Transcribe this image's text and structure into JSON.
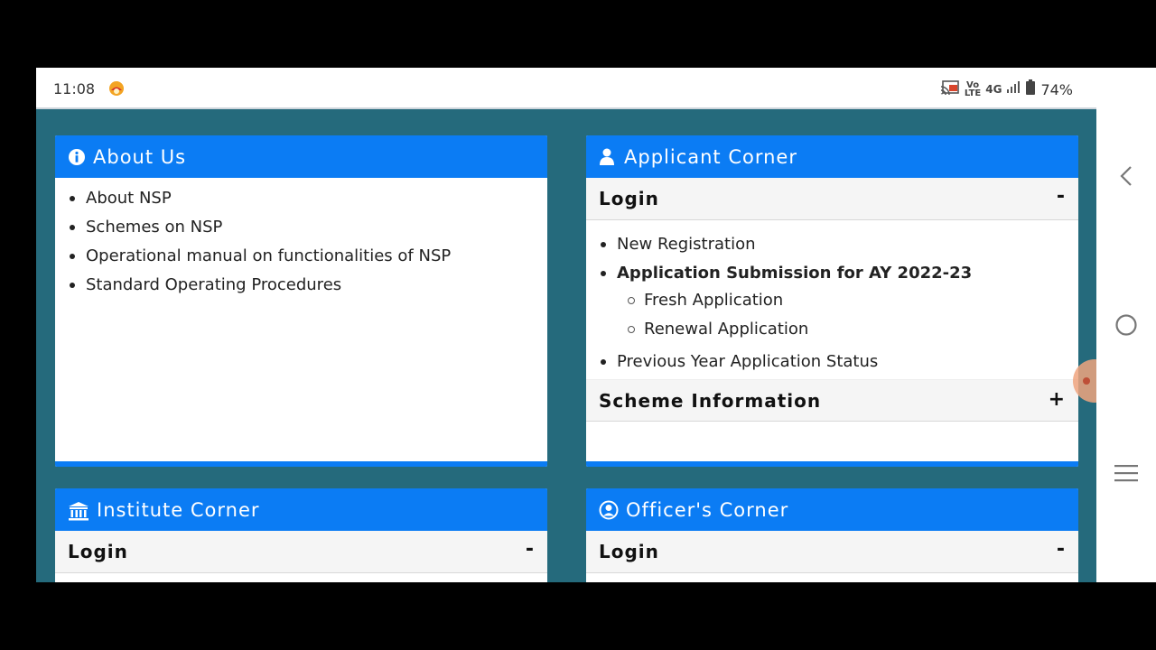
{
  "status": {
    "time": "11:08",
    "net_vo": "Vo",
    "net_lte": "LTE",
    "net_type": "4G",
    "battery": "74%"
  },
  "about": {
    "title": "About Us",
    "items": [
      "About NSP",
      "Schemes on NSP",
      "Operational manual on functionalities of NSP",
      "Standard Operating Procedures"
    ]
  },
  "applicant": {
    "title": "Applicant Corner",
    "login_label": "Login",
    "login_toggle": "-",
    "new_registration": "New Registration",
    "submission": "Application Submission for AY 2022-23",
    "fresh": "Fresh Application",
    "renewal": "Renewal Application",
    "previous": "Previous Year Application Status",
    "scheme_label": "Scheme Information",
    "scheme_toggle": "+"
  },
  "institute": {
    "title": "Institute Corner",
    "login_label": "Login",
    "login_toggle": "-"
  },
  "officer": {
    "title": "Officer's Corner",
    "login_label": "Login",
    "login_toggle": "-"
  },
  "colors": {
    "header_blue": "#0b7cf4",
    "page_teal": "#256a7c"
  },
  "icons": {
    "about": "info-circle-icon",
    "applicant": "user-icon",
    "institute": "institution-icon",
    "officer": "user-circle-icon",
    "nav_back": "back-chevron-icon",
    "nav_home": "home-circle-icon",
    "nav_recents": "menu-lines-icon"
  }
}
